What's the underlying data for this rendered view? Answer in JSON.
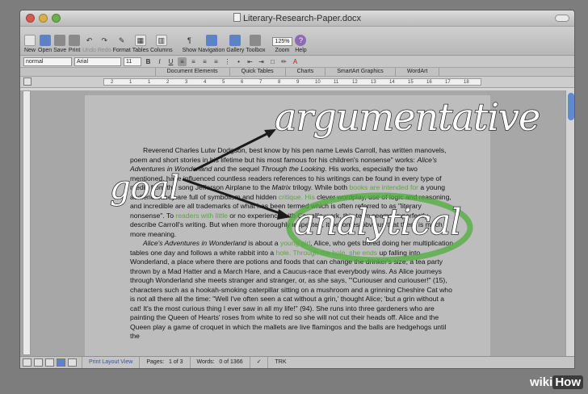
{
  "window": {
    "title": "Literary-Research-Paper.docx"
  },
  "toolbar": {
    "items": [
      "New",
      "Open",
      "Save",
      "Print",
      "Undo",
      "Redo",
      "Format",
      "Tables",
      "Columns",
      "Show",
      "Navigation",
      "Gallery",
      "Toolbox",
      "Zoom",
      "Help"
    ],
    "zoom_value": "125%"
  },
  "format": {
    "style": "normal",
    "font": "Arial",
    "size": "11",
    "bold": "B",
    "italic": "I",
    "underline": "U",
    "font_color_label": "A"
  },
  "ribbon": {
    "tabs": [
      "Document Elements",
      "Quick Tables",
      "Charts",
      "SmartArt Graphics",
      "WordArt"
    ]
  },
  "ruler": {
    "marks": [
      "2",
      "1",
      "1",
      "2",
      "3",
      "4",
      "5",
      "6",
      "7",
      "8",
      "9",
      "10",
      "11",
      "12",
      "13",
      "14",
      "15",
      "16",
      "17",
      "18"
    ]
  },
  "document": {
    "p1_a": "Reverend Charles Lutw",
    "p1_b": " Dodgson, best know",
    "p1_c": " by his pen name Lewis Carroll, has written ma",
    "p1_d": "novels, poem",
    "p1_e": " and short stories in his lifetime but his most famous for his children's",
    "p1_f": "nonsense\" works: ",
    "p1_g": "Alice's Adventures in Wonderland",
    "p1_h": " and the sequel ",
    "p1_i": "Through the Looking",
    "p1_j": ". His works, especially the two mentioned, have influenced countless readers",
    "p1_k": " references to his writings can be found in every type of media from the song",
    "p1_l": "Jefferson Airplane to the ",
    "p1_m": "Matrix",
    "p1_n": " trilogy. While both ",
    "p1_o": "books are intended for",
    "p1_p": " a young audience, they are full of symbolism and hidden ",
    "p1_q": "critique. His",
    "p1_r": " clever wordplay, use of logic and reasoning, and incredible",
    "p1_s": " are all trademarks of",
    "p1_t": " what has been termed which is often referred to as \"literary nonsense\". To ",
    "p1_u": "readers with little",
    "p1_v": " or no experience with Carroll's work, this term seems to perfectly describe Carroll's writing. But when more thoroughly inspected, it becomes obvious",
    "p1_w": " that there is much more meaning.",
    "p2_a": "Alice's Adventures in Wonderland",
    "p2_b": " is about a ",
    "p2_c": "young girl",
    "p2_d": ", Alice, who gets bored doing her multiplication tables one day and follows a white rabbit into a ",
    "p2_e": "hole. Through the hole, she ends",
    "p2_f": " up falling into Wonderland, a place where there are potions and foods that can change the drinker's size, a tea party thrown by a Mad Hatter and a March Hare, and a Caucus-race that everybody wins. As Alice journeys through Wonderland she meets stranger and stranger, or, as she says, \"'Curiouser and curiouser!\" (15), characters such as a hookah-smoking caterpillar sitting on a mushroom and a grinning Cheshire Cat who is not all there all the time: \"Well I've often seen a cat without a grin,' thought Alice; 'but a grin without a cat! It's the most curious thing I ever saw in all my life!\" (94). She runs into three gardeners who are painting the Queen of Hearts' roses from white to red so she will not cut their heads off. Alice and the Queen play a game of croquet in which the mallets are live flamingos and the balls are hedgehogs until the"
  },
  "status": {
    "view": "Print Layout View",
    "pages_label": "Pages:",
    "pages_value": "1 of 3",
    "words_label": "Words:",
    "words_value": "0 of 1366",
    "trk": "TRK"
  },
  "overlay": {
    "word_top": "argumentative",
    "word_left": "goal",
    "word_right": "analytical",
    "arrow_color": "#1a1a1a",
    "ellipse_color": "#4fae3c"
  },
  "watermark": {
    "wiki": "wiki",
    "how": "How"
  },
  "colors": {
    "highlight_text": "#62a146",
    "scroll_thumb": "#5f89d1"
  }
}
